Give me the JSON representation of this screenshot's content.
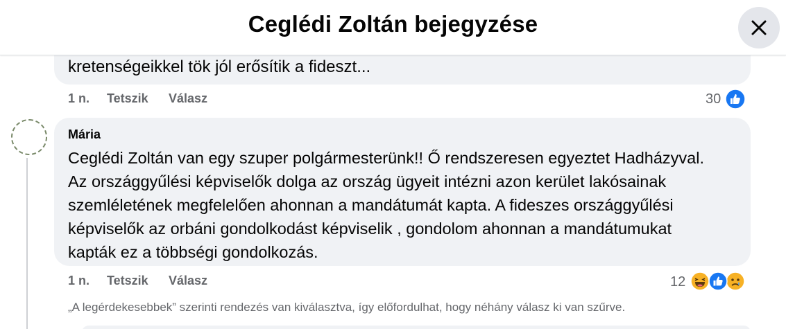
{
  "header": {
    "title": "Ceglédi Zoltán bejegyzése",
    "close_icon": "close-icon"
  },
  "previous_comment": {
    "text_tail": "kretenségeikkel tök jól erősítik a fideszt...",
    "time": "1 n.",
    "like_label": "Tetszik",
    "reply_label": "Válasz",
    "reaction_count": "30",
    "reactions": [
      "like-icon"
    ]
  },
  "comment": {
    "author": "Mária",
    "lines": [
      "Ceglédi Zoltán van egy szuper polgármesterünk!! Ő rendszeresen egyeztet Hadházyval.",
      "Az országgyűlési képviselők dolga az ország ügyeit intézni azon kerület lakósainak",
      "szemléletének megfelelően ahonnan a mandátumát kapta. A fideszes országgyűlési",
      "képviselők az orbáni gondolkodást képviselik , gondolom ahonnan a mandátumukat",
      "kapták ez a többségi gondolkozás."
    ],
    "time": "1 n.",
    "like_label": "Tetszik",
    "reply_label": "Válasz",
    "reaction_count": "12",
    "reactions": [
      "haha-icon",
      "like-icon",
      "sad-icon"
    ]
  },
  "sort_note": "„A legérdekesebbek” szerinti rendezés van kiválasztva, így előfordulhat, hogy néhány válasz ki van szűrve.",
  "colors": {
    "bubble": "#f0f2f5",
    "secondary_text": "#65676b",
    "like_blue": "#1877f2",
    "emoji_yellow": "#f7b125"
  }
}
